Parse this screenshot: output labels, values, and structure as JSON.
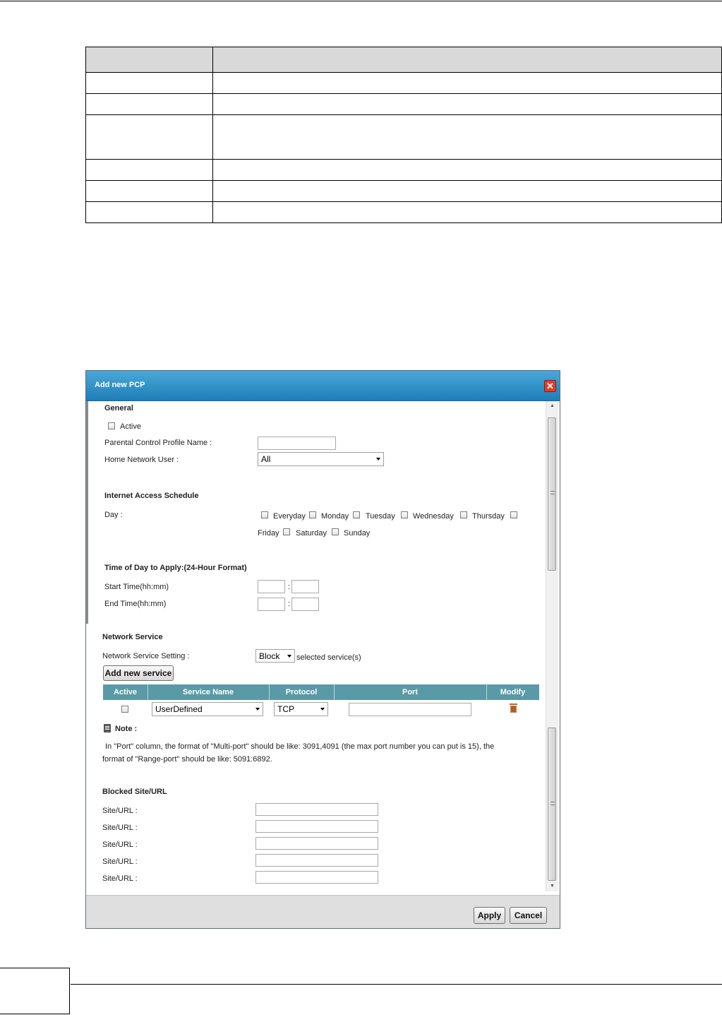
{
  "reference_table": {
    "header": [
      "",
      ""
    ],
    "rows": [
      [
        "",
        ""
      ],
      [
        "",
        ""
      ],
      [
        "",
        ""
      ],
      [
        "",
        ""
      ],
      [
        "",
        ""
      ],
      [
        "",
        ""
      ]
    ]
  },
  "dialog": {
    "title": "Add new PCP",
    "general": {
      "heading": "General",
      "active_label": "Active",
      "profile_name_label": "Parental Control Profile Name :",
      "profile_name_value": "",
      "home_user_label": "Home Network User :",
      "home_user_value": "All"
    },
    "schedule": {
      "heading": "Internet Access Schedule",
      "day_label": "Day :",
      "days": [
        "Everyday",
        "Monday",
        "Tuesday",
        "Wednesday",
        "Thursday",
        "Friday",
        "Saturday",
        "Sunday"
      ]
    },
    "time": {
      "heading": "Time of Day to Apply:(24-Hour Format)",
      "start_label": "Start Time(hh:mm)",
      "end_label": "End Time(hh:mm)",
      "separator": ":"
    },
    "network_service": {
      "heading": "Network Service",
      "setting_label": "Network Service Setting :",
      "setting_value": "Block",
      "setting_suffix": "selected service(s)",
      "add_button": "Add new service",
      "columns": [
        "Active",
        "Service Name",
        "Protocol",
        "Port",
        "Modify"
      ],
      "row": {
        "service_name": "UserDefined",
        "protocol": "TCP",
        "port": ""
      }
    },
    "note": {
      "label": "Note :",
      "line1": "In \"Port\" column, the format of \"Multi-port\" should be like: 3091,4091 (the max port number you can put is 15), the",
      "line2": "format of \"Range-port\" should be like: 5091:6892."
    },
    "blocked": {
      "heading": "Blocked Site/URL",
      "label": "Site/URL :"
    },
    "buttons": {
      "apply": "Apply",
      "cancel": "Cancel"
    }
  }
}
